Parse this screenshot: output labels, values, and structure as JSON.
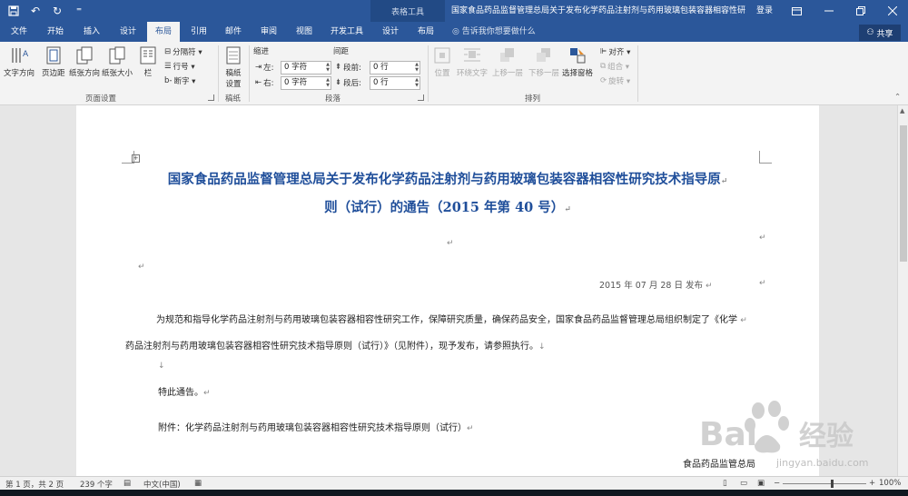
{
  "titlebar": {
    "context_tab": "表格工具",
    "doc_title": "国家食品药品监督管理总局关于发布化学药品注射剂与药用玻璃包装容器相容性研...",
    "login": "登录",
    "qat_save": "💾",
    "qat_undo": "↶",
    "qat_redo": "↻",
    "qat_more": "⁼"
  },
  "tabs": [
    "文件",
    "开始",
    "插入",
    "设计",
    "布局",
    "引用",
    "邮件",
    "审阅",
    "视图",
    "开发工具",
    "设计",
    "布局"
  ],
  "tell_me": "告诉我你想要做什么",
  "share": "共享",
  "ribbon": {
    "page_setup": {
      "text_direction": "文字方向",
      "margins": "页边距",
      "orientation": "纸张方向",
      "size": "纸张大小",
      "columns": "栏",
      "breaks": "分隔符 ▾",
      "line_numbers": "行号 ▾",
      "hyphenation": "断字 ▾",
      "label": "页面设置"
    },
    "draft": {
      "paper": "稿纸",
      "setup": "设置",
      "label": "稿纸"
    },
    "paragraph": {
      "indent_title": "缩进",
      "spacing_title": "间距",
      "left_label": "左:",
      "right_label": "右:",
      "before_label": "段前:",
      "after_label": "段后:",
      "left_value": "0 字符",
      "right_value": "0 字符",
      "before_value": "0 行",
      "after_value": "0 行",
      "label": "段落"
    },
    "arrange": {
      "position": "位置",
      "wrap": "环绕文字",
      "forward": "上移一层",
      "backward": "下移一层",
      "selection_pane": "选择窗格",
      "align": "对齐 ▾",
      "group": "组合 ▾",
      "rotate": "旋转 ▾",
      "label": "排列"
    }
  },
  "document": {
    "title_line1": "国家食品药品监督管理总局关于发布化学药品注射剂与药用玻璃包装容器相容性研究技术指导原",
    "title_line2": "则（试行）的通告（2015 年第 40 号）",
    "date": "2015 年 07 月 28 日  发布",
    "body_line1": "为规范和指导化学药品注射剂与药用玻璃包装容器相容性研究工作，保障研究质量，确保药品安全，国家食品药品监督管理总局组织制定了《化学",
    "body_line2": "药品注射剂与药用玻璃包装容器相容性研究技术指导原则（试行）》（见附件），现予发布，请参照执行。",
    "notice": "特此通告。",
    "attachment": "附件：化学药品注射剂与药用玻璃包装容器相容性研究技术指导原则（试行）",
    "signature": "食品药品监管总局",
    "para_mark": "↵",
    "line_mark": "↓"
  },
  "status": {
    "page": "第 1 页，共 2 页",
    "words": "239 个字",
    "lang": "中文(中国)",
    "zoom": "100%"
  },
  "watermark": {
    "brand": "Bai",
    "brand_cn": "经验",
    "url": "jingyan.baidu.com"
  },
  "colors": {
    "accent": "#2b579a",
    "title_text": "#1f4e9a"
  }
}
